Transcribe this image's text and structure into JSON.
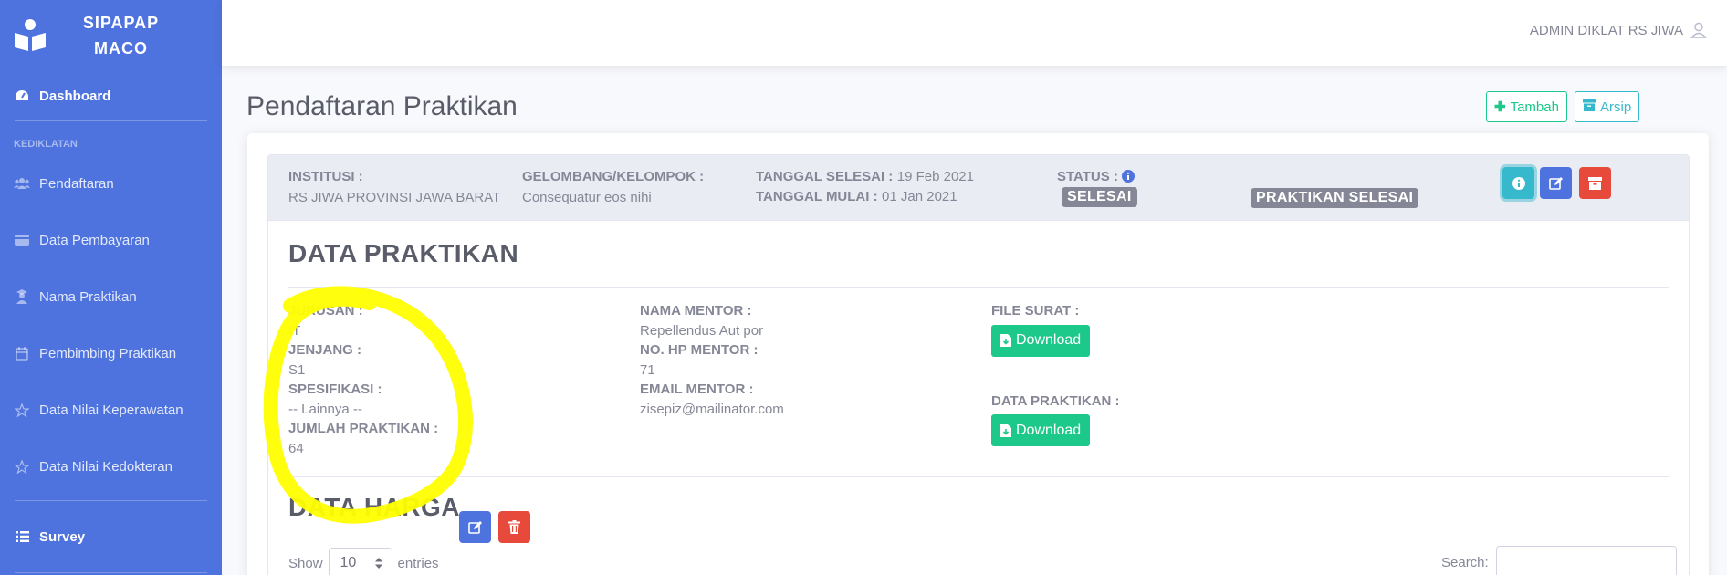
{
  "app": {
    "brand_line1": "SIPAPAP",
    "brand_line2": "MACO"
  },
  "sidebar": {
    "dashboard": "Dashboard",
    "heading": "KEDIKLATAN",
    "items": [
      {
        "label": "Pendaftaran",
        "icon": "users-icon"
      },
      {
        "label": "Data Pembayaran",
        "icon": "credit-card-icon"
      },
      {
        "label": "Nama Praktikan",
        "icon": "user-graduate-icon"
      },
      {
        "label": "Pembimbing Praktikan",
        "icon": "calendar-icon"
      },
      {
        "label": "Data Nilai Keperawatan",
        "icon": "star-icon"
      },
      {
        "label": "Data Nilai Kedokteran",
        "icon": "star-icon"
      }
    ],
    "survey": "Survey"
  },
  "topbar": {
    "user_name": "ADMIN DIKLAT RS JIWA"
  },
  "page": {
    "title": "Pendaftaran Praktikan",
    "tambah_label": "Tambah",
    "arsip_label": "Arsip"
  },
  "header": {
    "institusi_label": "INSTITUSI :",
    "institusi_value": "RS JIWA PROVINSI JAWA BARAT",
    "gelombang_label": "GELOMBANG/KELOMPOK :",
    "gelombang_value": "Consequatur eos nihi",
    "tgl_selesai_label": "TANGGAL SELESAI :",
    "tgl_selesai_value": "19 Feb 2021",
    "tgl_mulai_label": "TANGGAL MULAI :",
    "tgl_mulai_value": "01 Jan 2021",
    "status_label": "STATUS :",
    "status_badge": "SELESAI",
    "praktikan_badge": "PRAKTIKAN SELESAI"
  },
  "data_praktikan": {
    "title": "DATA PRAKTIKAN",
    "jurusan_label": "JURUSAN :",
    "jurusan_value": "IT",
    "jenjang_label": "JENJANG :",
    "jenjang_value": "S1",
    "spesifikasi_label": "SPESIFIKASI :",
    "spesifikasi_value": "-- Lainnya --",
    "jumlah_label": "JUMLAH PRAKTIKAN :",
    "jumlah_value": "64",
    "nama_mentor_label": "NAMA MENTOR :",
    "nama_mentor_value": "Repellendus Aut por",
    "hp_mentor_label": "NO. HP MENTOR :",
    "hp_mentor_value": "71",
    "email_mentor_label": "EMAIL MENTOR :",
    "email_mentor_value": "zisepiz@mailinator.com",
    "file_surat_label": "FILE SURAT :",
    "data_praktikan_label": "DATA PRAKTIKAN :",
    "download_label": "Download"
  },
  "data_harga": {
    "title": "DATA HARGA",
    "show_label": "Show",
    "entries_value": "10",
    "entries_label": "entries",
    "search_label": "Search:"
  },
  "colors": {
    "primary": "#4e73df",
    "success": "#1cc88a",
    "info": "#36b9cc",
    "danger": "#e74a3b",
    "secondary": "#858796",
    "annotation": "#ffff00"
  }
}
